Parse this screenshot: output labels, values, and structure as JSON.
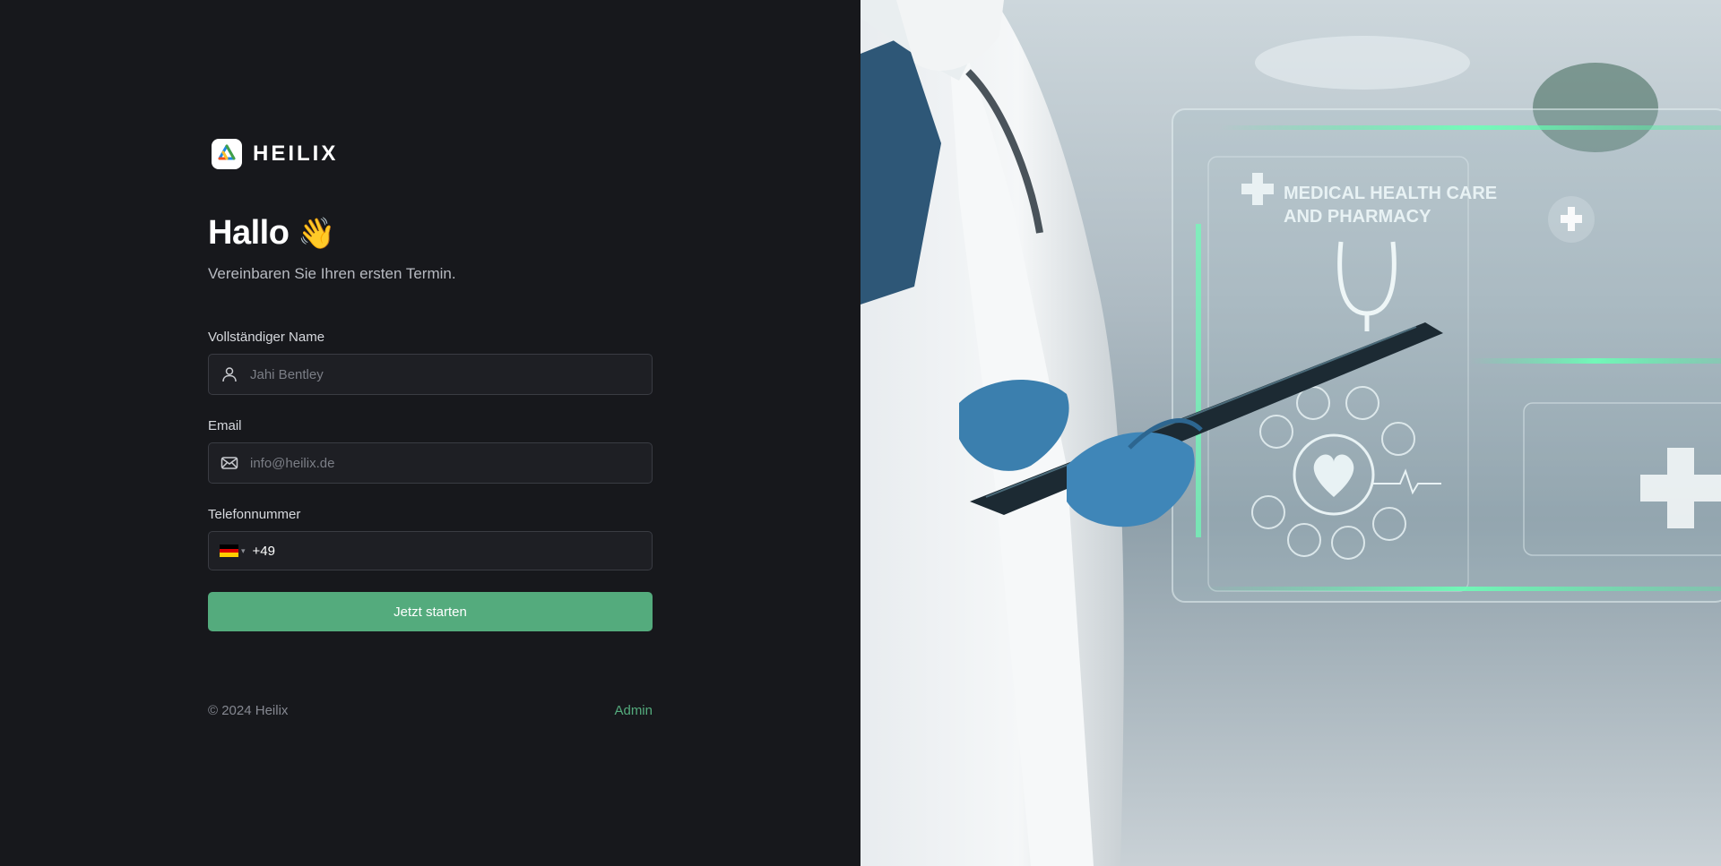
{
  "brand": {
    "name": "HEILIX",
    "logo_icon": "heilix-logo-icon"
  },
  "greeting": {
    "title": "Hallo",
    "emoji": "👋",
    "subtitle": "Vereinbaren Sie Ihren ersten Termin."
  },
  "form": {
    "name": {
      "label": "Vollständiger Name",
      "placeholder": "Jahi Bentley",
      "value": "",
      "icon": "user-icon"
    },
    "email": {
      "label": "Email",
      "placeholder": "info@heilix.de",
      "value": "",
      "icon": "mail-icon"
    },
    "phone": {
      "label": "Telefonnummer",
      "country": "Germany",
      "flag_icon": "germany-flag-icon",
      "code": "+49",
      "value": ""
    },
    "submit_label": "Jetzt starten"
  },
  "footer": {
    "copyright": "© 2024 Heilix",
    "admin_link": "Admin"
  },
  "hero": {
    "hud_line1": "MEDICAL HEALTH CARE",
    "hud_line2": "AND PHARMACY"
  },
  "colors": {
    "background": "#17181c",
    "input_bg": "#1e1f24",
    "input_border": "#3a3c43",
    "accent": "#54ab7d",
    "muted_text": "#858891"
  }
}
